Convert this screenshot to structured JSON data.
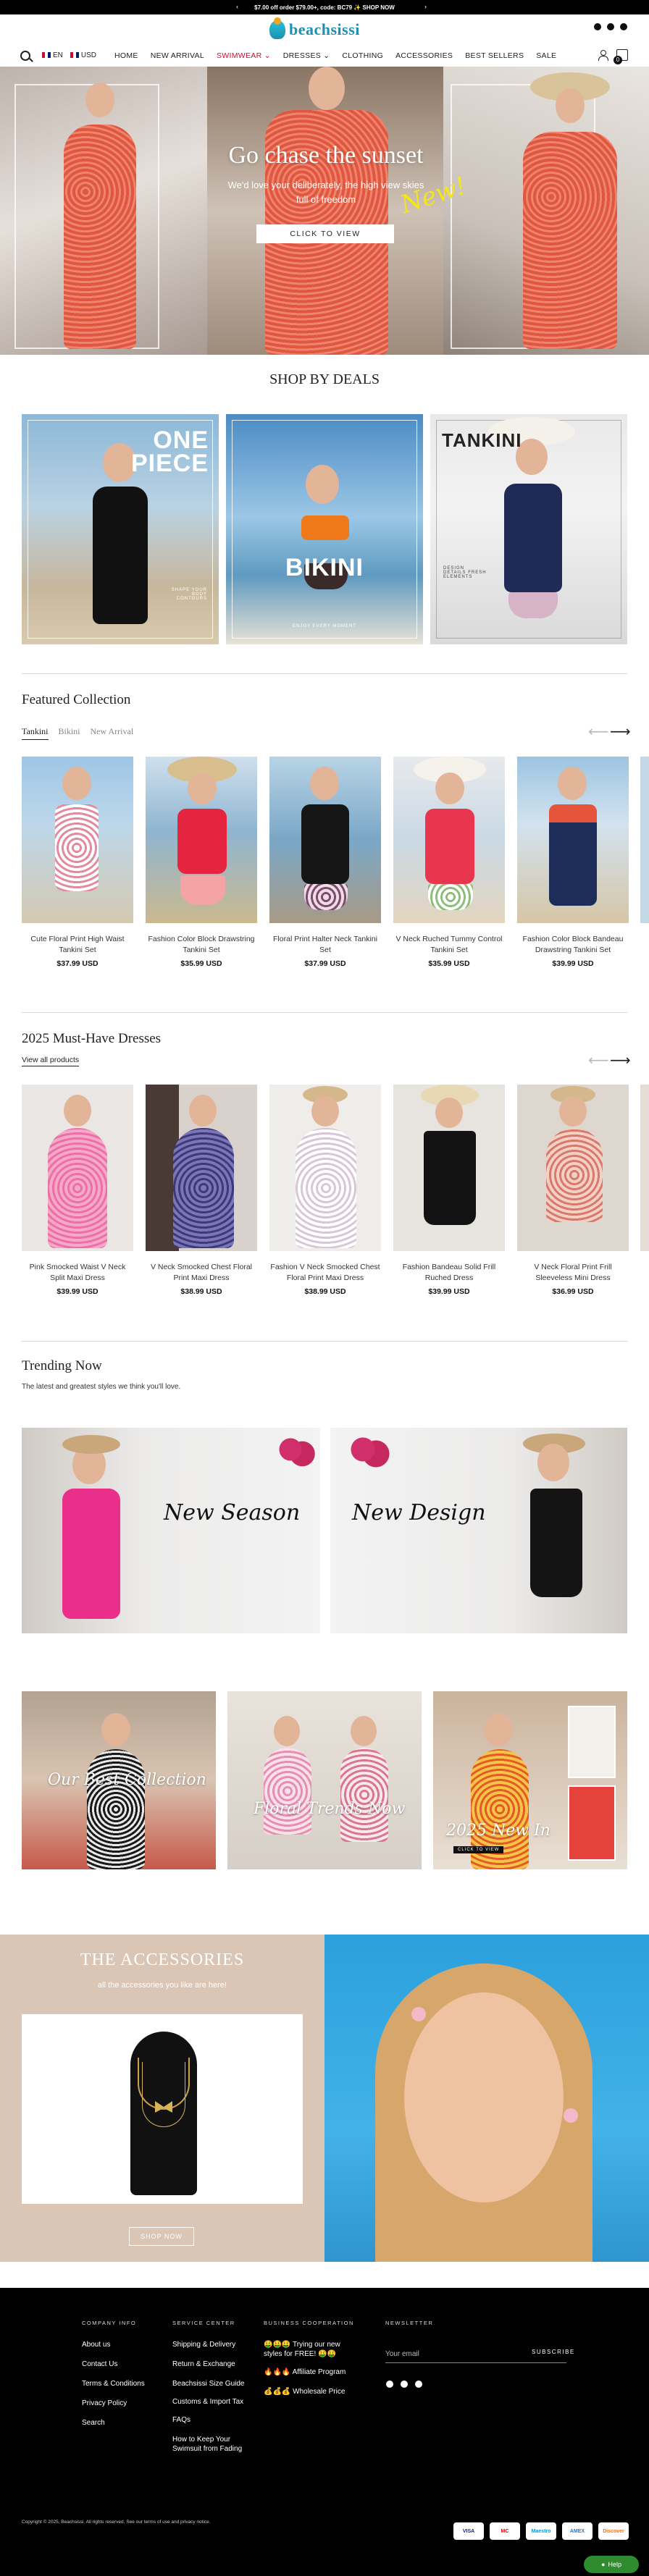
{
  "announcement": {
    "text": "$7.00 off order $79.00+, code: BC79 ✨ SHOP NOW"
  },
  "header": {
    "logo_text": "beachsissi",
    "language": "EN",
    "currency": "USD",
    "cart_count": "0",
    "menu": [
      {
        "label": "HOME"
      },
      {
        "label": "NEW ARRIVAL"
      },
      {
        "label": "SWIMWEAR ⌄"
      },
      {
        "label": "DRESSES ⌄"
      },
      {
        "label": "CLOTHING"
      },
      {
        "label": "ACCESSORIES"
      },
      {
        "label": "BEST SELLERS"
      },
      {
        "label": "SALE"
      }
    ]
  },
  "hero": {
    "badge": "New!",
    "title": "Go chase the sunset",
    "subtitle": "We'd love your deliberately, the high view skies full of freedom",
    "button": "CLICK TO VIEW"
  },
  "deals": {
    "title": "SHOP BY DEALS",
    "cards": [
      {
        "big": "ONE\nPIECE",
        "small": "SHAPE YOUR BODY CONTOURS"
      },
      {
        "big": "BIKINI",
        "small": "ENJOY EVERY MOMENT"
      },
      {
        "big": "TANKINI",
        "small": "DESIGN DETAILS FRESH ELEMENTS"
      }
    ]
  },
  "featured": {
    "title": "Featured Collection",
    "tabs": [
      "Tankini",
      "Bikini",
      "New Arrival"
    ],
    "products": [
      {
        "name": "Cute Floral Print High Waist Tankini Set",
        "price": "$37.99 USD"
      },
      {
        "name": "Fashion Color Block Drawstring Tankini Set",
        "price": "$35.99 USD"
      },
      {
        "name": "Floral Print Halter Neck Tankini Set",
        "price": "$37.99 USD"
      },
      {
        "name": "V Neck Ruched Tummy Control Tankini Set",
        "price": "$35.99 USD"
      },
      {
        "name": "Fashion Color Block Bandeau Drawstring Tankini Set",
        "price": "$39.99 USD"
      }
    ]
  },
  "dresses": {
    "title": "2025 Must-Have Dresses",
    "view_all": "View all products",
    "products": [
      {
        "name": "Pink Smocked Waist V Neck Split Maxi Dress",
        "price": "$39.99 USD"
      },
      {
        "name": "V Neck Smocked Chest Floral Print Maxi Dress",
        "price": "$38.99 USD"
      },
      {
        "name": "Fashion V Neck Smocked Chest Floral Print Maxi Dress",
        "price": "$38.99 USD"
      },
      {
        "name": "Fashion Bandeau Solid Frill Ruched Dress",
        "price": "$39.99 USD"
      },
      {
        "name": "V Neck Floral Print Frill Sleeveless Mini Dress",
        "price": "$36.99 USD"
      }
    ]
  },
  "trending": {
    "title": "Trending Now",
    "subtitle": "The latest and greatest styles we think you'll love.",
    "banner_left": "New Season",
    "banner_right": "New Design",
    "tiles": [
      {
        "caption": "Our Best Collection"
      },
      {
        "caption": "Floral Trends Now"
      },
      {
        "caption": "2025 New In",
        "button": "CLICK TO VIEW"
      }
    ]
  },
  "accessories": {
    "title": "THE ACCESSORIES",
    "subtitle": "all the accessories you like are here!",
    "button": "SHOP NOW"
  },
  "footer": {
    "company": {
      "heading": "COMPANY INFO",
      "links": [
        "About us",
        "Contact Us",
        "Terms & Conditions",
        "Privacy Policy",
        "Search"
      ]
    },
    "service": {
      "heading": "SERVICE CENTER",
      "links": [
        "Shipping & Delivery",
        "Return & Exchange",
        "Beachsissi Size Guide",
        "Customs & Import Tax",
        "FAQs",
        "How to Keep Your Swimsuit from Fading"
      ]
    },
    "business": {
      "heading": "BUSINESS COOPERATION",
      "links": [
        "🤑🤑🤑 Trying our new styles for FREE! 🤑🤑",
        "🔥🔥🔥 Affiliate Program",
        "💰💰💰 Wholesale Price"
      ]
    },
    "newsletter": {
      "heading": "NEWSLETTER",
      "placeholder": "Your email",
      "button": "SUBSCRIBE"
    },
    "copyright": "Copyright © 2025, Beachsissi. All rights reserved. See our terms of use and privacy notice.",
    "payments": [
      "VISA",
      "MC",
      "Maestro",
      "AMEX",
      "Discover"
    ],
    "help": "Help"
  },
  "colors": {
    "accent_red": "#c8102e",
    "footer_bg": "#000000",
    "accessories_bg": "#dbc6b5",
    "help_green": "#2e8b2e"
  }
}
